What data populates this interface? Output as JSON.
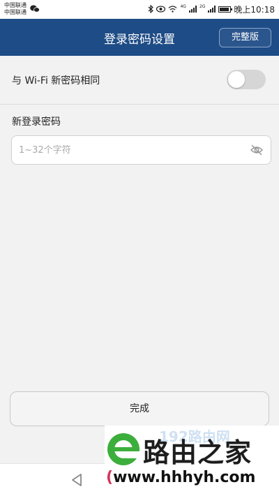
{
  "status_bar": {
    "carrier_1": "中国联通",
    "carrier_2": "中国联通",
    "net_1": "4G",
    "net_2": "2G",
    "time": "晚上10:18"
  },
  "header": {
    "title": "登录密码设置",
    "full_version_label": "完整版",
    "bg_color": "#1e4c86"
  },
  "same_as_wifi": {
    "label": "与 Wi-Fi 新密码相同",
    "enabled": false
  },
  "new_password": {
    "label": "新登录密码",
    "value": "",
    "placeholder": "1~32个字符"
  },
  "done_label": "完成",
  "watermark": {
    "brand": "路由之家",
    "url_open": "(",
    "url": "www.hhhyh.com",
    "faded_text": "192路由网"
  },
  "icons": {
    "wechat": "wechat-icon",
    "eye_off": "eye-off-icon",
    "back": "back-icon",
    "home": "home-icon"
  }
}
